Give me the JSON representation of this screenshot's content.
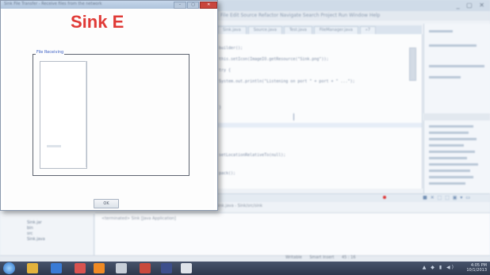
{
  "ide": {
    "menu": "File  Edit  Source  Refactor  Navigate  Search  Project  Run  Window  Help",
    "window_controls": "_ ▢ ✕",
    "tabs": [
      "Sink.java",
      "Source.java",
      "Test.java",
      "FileManager.java",
      "»7"
    ],
    "code_lines": [
      "    builder();",
      "    this.setIcon(ImageIO.getResource(\"Sink.png\"));",
      "    try {",
      "        System.out.println(\"Listening on port \" + port + \" ...\");",
      "",
      "    }",
      "",
      "    setLocationRelativeTo(null);",
      "",
      "    pack();"
    ],
    "status_text": "Sink.java - Sink/src/sink",
    "console_text": "<terminated> Sink [Java Application]",
    "tree_items": [
      "Sink.jar",
      "bin",
      "src",
      "Sink.java"
    ],
    "status_cells": "Writable      Smart Insert      45 : 16",
    "console_icons": "■ ✕ ⬚ ⬚ ▣ ▾ ▭"
  },
  "taskbar": {
    "tray": "▲ ◆ ▮ ◀)",
    "time": "4:05 PM",
    "date": "10/1/2013",
    "icons": [
      {
        "name": "explorer-icon",
        "color": "#e3b23c"
      },
      {
        "name": "media-icon",
        "color": "#3a7bd5"
      },
      {
        "name": "chrome-icon",
        "color": "#d9534f"
      },
      {
        "name": "vlc-icon",
        "color": "#f08a24"
      },
      {
        "name": "document-icon",
        "color": "#c7ced8"
      },
      {
        "name": "presentation-icon",
        "color": "#c94a3d"
      },
      {
        "name": "eclipse-icon",
        "color": "#3d4f8c"
      },
      {
        "name": "java-icon",
        "color": "#dfe3ea"
      }
    ]
  },
  "window": {
    "title": "Sink File Transfer - Receive files from the network",
    "controls": [
      "–",
      "▢",
      "✕"
    ],
    "heading": "Sink E",
    "panel_legend": "File Receiving",
    "ok_label": "OK"
  }
}
